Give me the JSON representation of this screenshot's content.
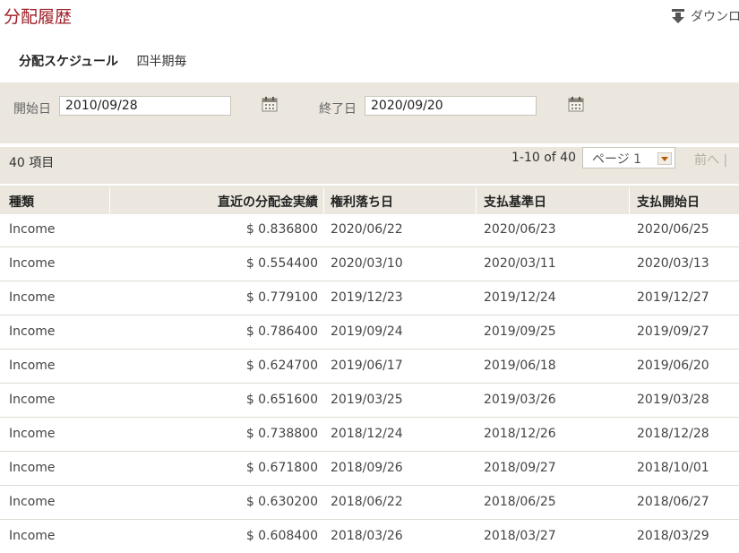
{
  "header": {
    "title": "分配履歴",
    "download_label": "ダウンロ"
  },
  "schedule": {
    "label": "分配スケジュール",
    "value": "四半期毎"
  },
  "filter": {
    "start_label": "開始日",
    "start_value": "2010/09/28",
    "end_label": "終了日",
    "end_value": "2020/09/20"
  },
  "pager": {
    "count": "40 項目",
    "range": "1-10 of 40",
    "page_select": "ページ 1",
    "prev_label": "前へ |"
  },
  "table": {
    "columns": [
      "種類",
      "直近の分配金実績",
      "権利落ち日",
      "支払基準日",
      "支払開始日"
    ],
    "rows": [
      [
        "Income",
        "$ 0.836800",
        "2020/06/22",
        "2020/06/23",
        "2020/06/25"
      ],
      [
        "Income",
        "$ 0.554400",
        "2020/03/10",
        "2020/03/11",
        "2020/03/13"
      ],
      [
        "Income",
        "$ 0.779100",
        "2019/12/23",
        "2019/12/24",
        "2019/12/27"
      ],
      [
        "Income",
        "$ 0.786400",
        "2019/09/24",
        "2019/09/25",
        "2019/09/27"
      ],
      [
        "Income",
        "$ 0.624700",
        "2019/06/17",
        "2019/06/18",
        "2019/06/20"
      ],
      [
        "Income",
        "$ 0.651600",
        "2019/03/25",
        "2019/03/26",
        "2019/03/28"
      ],
      [
        "Income",
        "$ 0.738800",
        "2018/12/24",
        "2018/12/26",
        "2018/12/28"
      ],
      [
        "Income",
        "$ 0.671800",
        "2018/09/26",
        "2018/09/27",
        "2018/10/01"
      ],
      [
        "Income",
        "$ 0.630200",
        "2018/06/22",
        "2018/06/25",
        "2018/06/27"
      ],
      [
        "Income",
        "$ 0.608400",
        "2018/03/26",
        "2018/03/27",
        "2018/03/29"
      ]
    ]
  },
  "colors": {
    "title": "#9e1f26",
    "panel": "#ebe7de",
    "accent": "#b85b00"
  },
  "icons": {
    "download": "download-icon",
    "calendar": "calendar-icon",
    "dropdown": "chevron-down-icon"
  }
}
